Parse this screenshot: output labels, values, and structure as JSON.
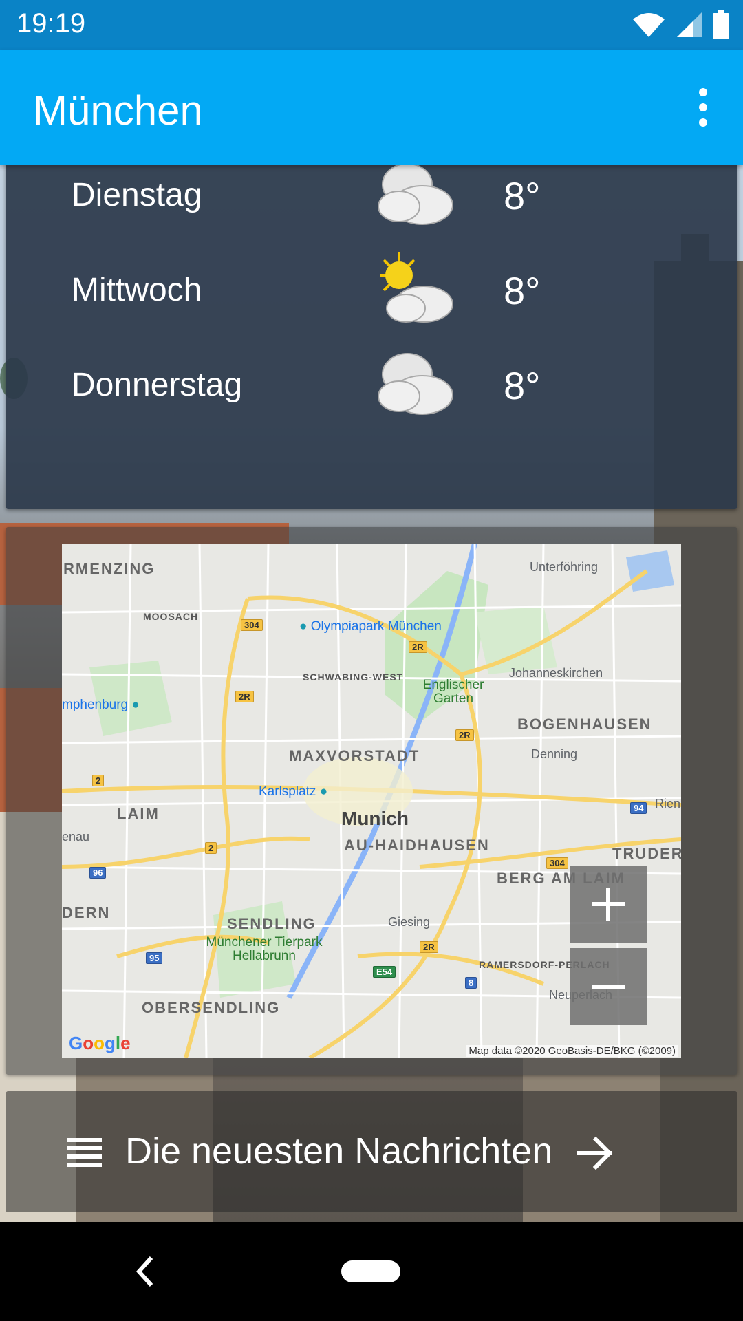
{
  "status_bar": {
    "time": "19:19",
    "icons": [
      "wifi-icon",
      "signal-icon",
      "battery-icon"
    ]
  },
  "app_bar": {
    "title": "München",
    "menu_icon": "more-vert-icon",
    "color": "#03a9f4"
  },
  "forecast": [
    {
      "day": "Dienstag",
      "icon": "cloudy-icon",
      "temp": "8°"
    },
    {
      "day": "Mittwoch",
      "icon": "partly-sunny-icon",
      "temp": "8°"
    },
    {
      "day": "Donnerstag",
      "icon": "cloudy-icon",
      "temp": "8°"
    }
  ],
  "map": {
    "labels": {
      "rmenzing": "RMENZING",
      "unterfoehring": "Unterföhring",
      "moosach": "MOOSACH",
      "olympiapark": "Olympiapark München",
      "schwabing_west": "SCHWABING-WEST",
      "johanneskirchen": "Johanneskirchen",
      "englischer_garten": "Englischer Garten",
      "nymphenburg": "mphenburg",
      "bogenhausen": "BOGENHAUSEN",
      "denning": "Denning",
      "maxvorstadt": "MAXVORSTADT",
      "karlsplatz": "Karlsplatz",
      "laim": "LAIM",
      "munich": "Munich",
      "riem": "Rien",
      "pasing": "enau",
      "au_haidhausen": "AU-HAIDHAUSEN",
      "truderi": "TRUDERI",
      "berg_am_laim": "BERG AM LAIM",
      "hadern": "DERN",
      "sendling": "SENDLING",
      "giesing": "Giesing",
      "tierpark": "Münchener Tierpark Hellabrunn",
      "ramersdorf": "RAMERSDORF-PERLACH",
      "obersendling": "OBERSENDLING",
      "neuperlach": "Neuperlach"
    },
    "shields": {
      "a304a": "304",
      "a2r_top": "2R",
      "a2r_left": "2R",
      "a2r_right": "2R",
      "a2_left": "2",
      "a2_mid": "2",
      "a94": "94",
      "a304b": "304",
      "a96": "96",
      "a95": "95",
      "a2r_bottom": "2R",
      "e54": "E54",
      "a8": "8"
    },
    "zoom_in_icon": "plus-icon",
    "zoom_out_icon": "minus-icon",
    "logo": "Google",
    "attribution": "Map data ©2020 GeoBasis-DE/BKG (©2009)"
  },
  "news": {
    "label": "Die neuesten Nachrichten",
    "icon": "list-icon",
    "arrow_icon": "arrow-right-icon"
  },
  "nav_bar": {
    "back_icon": "back-icon",
    "home_icon": "home-pill-icon"
  }
}
